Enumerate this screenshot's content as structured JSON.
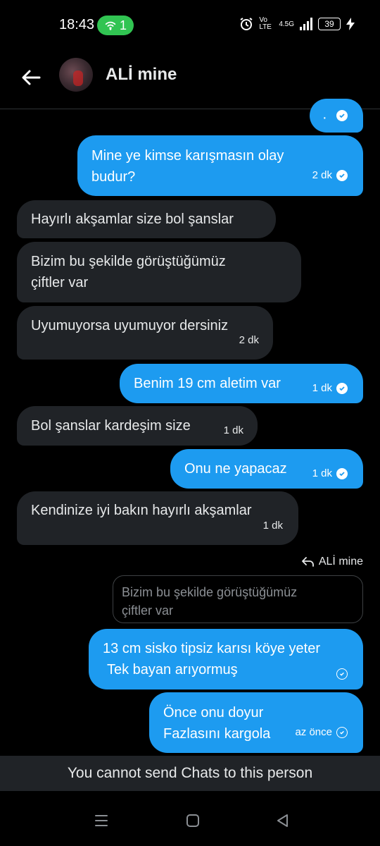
{
  "status_bar": {
    "time": "18:43",
    "hotspot_count": "1",
    "network_label": "Vo LTE",
    "network_speed": "4.5G",
    "battery": "39"
  },
  "header": {
    "contact_name": "ALİ mine"
  },
  "messages": [
    {
      "direction": "out",
      "text": "·",
      "time": ""
    },
    {
      "direction": "out",
      "text_line1": "Mine ye kimse karışmasın  olay",
      "text_line2": "budur?",
      "time": "2 dk"
    },
    {
      "direction": "in",
      "text": "Hayırlı akşamlar size bol şanslar"
    },
    {
      "direction": "in",
      "text_line1": "Bizim bu şekilde görüştüğümüz",
      "text_line2": "çiftler var"
    },
    {
      "direction": "in",
      "text": "Uyumuyorsa uyumuyor dersiniz",
      "time": "2 dk"
    },
    {
      "direction": "out",
      "text": "Benim 19 cm aletim var",
      "time": "1 dk"
    },
    {
      "direction": "in",
      "text": "Bol şanslar kardeşim size",
      "time": "1 dk"
    },
    {
      "direction": "out",
      "text": "Onu ne yapacaz",
      "time": "1 dk"
    },
    {
      "direction": "in",
      "text": "Kendinize iyi bakın hayırlı akşamlar",
      "time": "1 dk"
    },
    {
      "direction": "out",
      "reply_to": "ALİ mine",
      "quote_line1": "Bizim bu şekilde görüştüğümüz",
      "quote_line2": "çiftler var",
      "text_line1": "13 cm sisko tipsiz karısı köye yeter",
      "text_line2": "Tek bayan arıyormuş"
    },
    {
      "direction": "out",
      "text_line1": "Önce onu doyur",
      "text_line2": "Fazlasını kargola",
      "time": "az önce"
    }
  ],
  "footer": {
    "disabled_text": "You cannot send Chats to this person"
  },
  "icons": [
    "back-arrow-icon",
    "hotspot-icon",
    "alarm-icon",
    "signal-icon",
    "battery-icon",
    "charging-icon",
    "read-check-icon",
    "reply-icon",
    "recents-icon",
    "home-icon",
    "back-nav-icon"
  ],
  "colors": {
    "outgoing_bubble": "#1d9bf0",
    "incoming_bubble": "#202327",
    "background": "#000000"
  }
}
